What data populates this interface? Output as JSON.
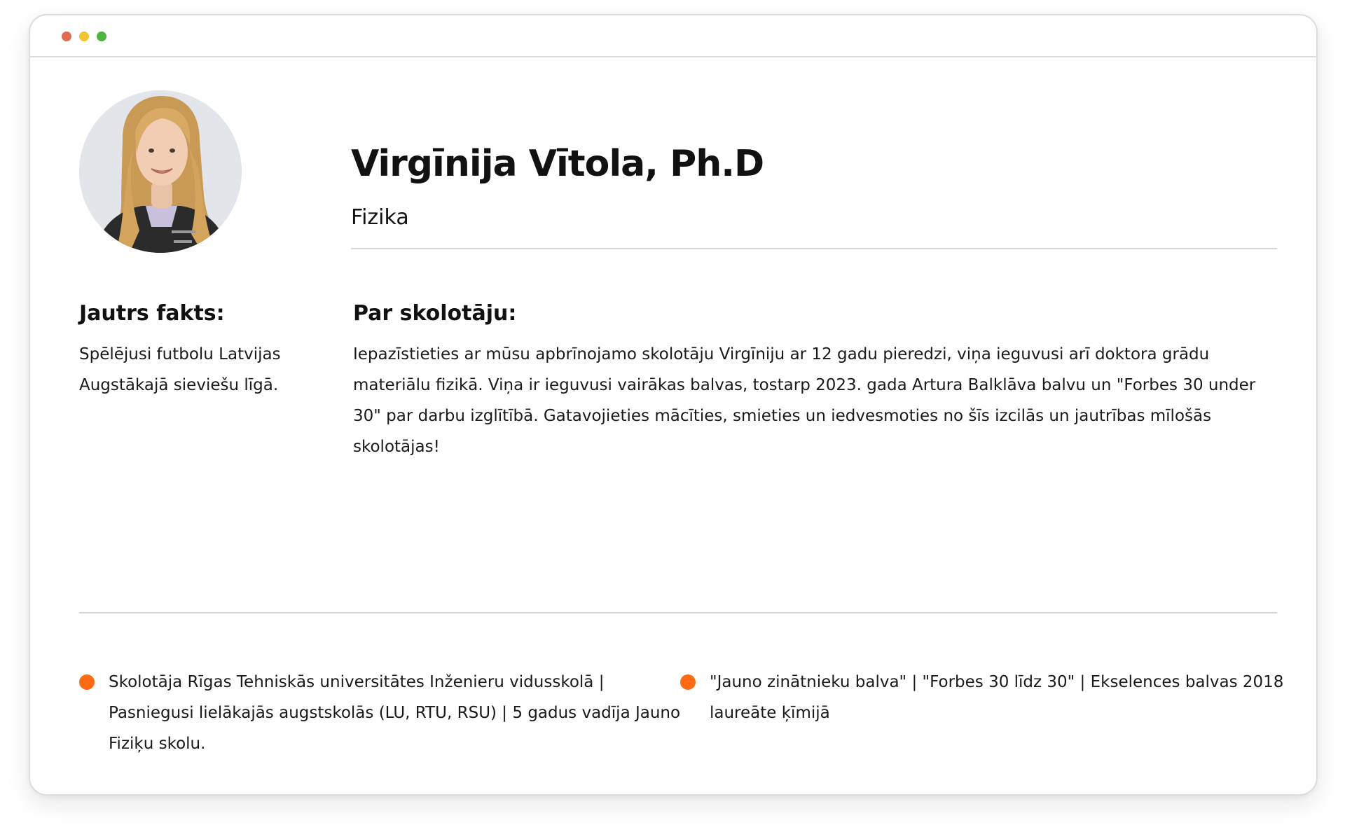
{
  "colors": {
    "dot_red": "#e06c4f",
    "dot_yellow": "#f3c530",
    "dot_green": "#4fb53f",
    "bullet_orange": "#ff6a13",
    "divider": "#d6d6d6"
  },
  "window": {
    "controls": [
      "close",
      "minimize",
      "maximize"
    ]
  },
  "profile": {
    "avatar_icon": "teacher-portrait-photo",
    "name": "Virgīnija Vītola, Ph.D",
    "subject": "Fizika"
  },
  "fun_fact": {
    "title": "Jautrs fakts:",
    "text": "Spēlējusi futbolu Latvijas Augstākajā sieviešu līgā."
  },
  "about": {
    "title": "Par skolotāju:",
    "text": "Iepazīstieties ar mūsu apbrīnojamo skolotāju Virgīniju ar 12 gadu pieredzi, viņa ieguvusi arī doktora grādu materiālu fizikā. Viņa ir ieguvusi vairākas balvas, tostarp 2023. gada Artura Balklāva balvu un \"Forbes 30 under 30\" par darbu izglītībā. Gatavojieties mācīties, smieties un iedvesmoties no šīs izcilās un jautrības mīlošās skolotājas!"
  },
  "highlights": [
    {
      "icon": "orange-bullet-icon",
      "text": "Skolotāja Rīgas Tehniskās universitātes Inženieru vidusskolā | Pasniegusi lielākajās augstskolās (LU, RTU, RSU) | 5 gadus vadīja Jauno Fiziķu skolu."
    },
    {
      "icon": "orange-bullet-icon",
      "text": "\"Jauno zinātnieku balva\" | \"Forbes 30 līdz 30\" | Ekselences balvas 2018 laureāte ķīmijā"
    }
  ]
}
